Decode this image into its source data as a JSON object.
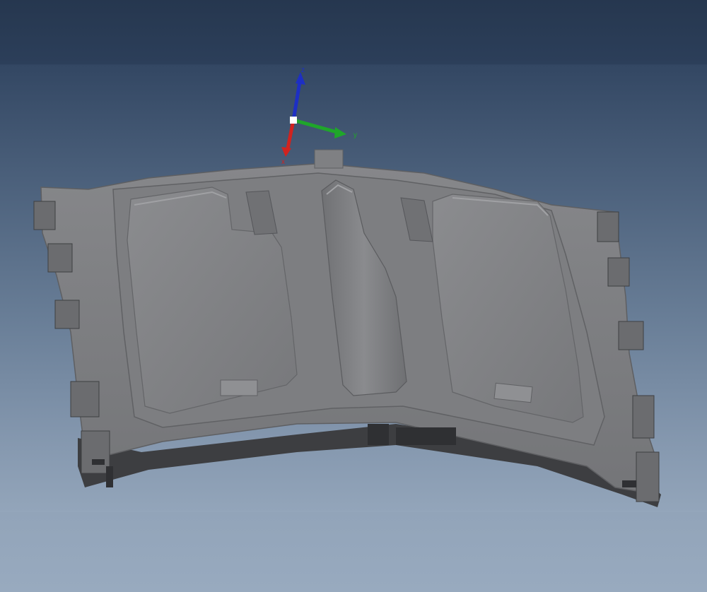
{
  "viewport": {
    "background_top": "#283a55",
    "background_bottom": "#97a9be",
    "part_color": "#7b7b7d"
  },
  "triad": {
    "z_label": "z",
    "y_label": "y",
    "x_label": "x",
    "z_color": "#1d2fc4",
    "y_color": "#1fa62a",
    "x_color": "#d0231f"
  }
}
